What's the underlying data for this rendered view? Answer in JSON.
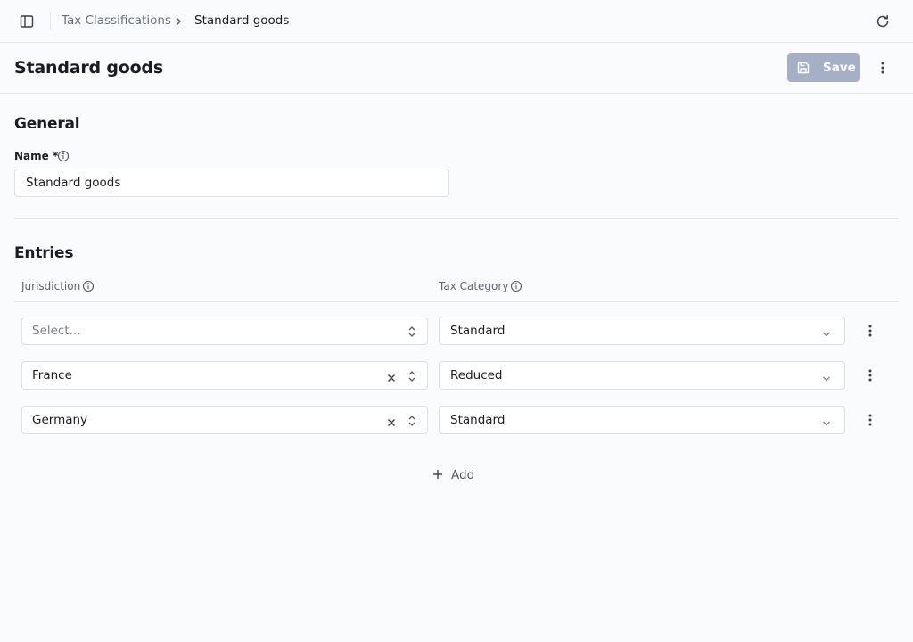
{
  "topbar": {
    "breadcrumb": [
      "Tax Classifications",
      "Standard goods"
    ]
  },
  "header": {
    "title": "Standard goods",
    "save_label": "Save"
  },
  "general": {
    "section_title": "General",
    "name_label": "Name *",
    "name_value": "Standard goods"
  },
  "entries": {
    "section_title": "Entries",
    "columns": [
      "Jurisdiction",
      "Tax Category"
    ],
    "rows": [
      {
        "jurisdiction": "Select...",
        "jurisdiction_placeholder": true,
        "tax_category": "Standard"
      },
      {
        "jurisdiction": "France",
        "tax_category": "Reduced"
      },
      {
        "jurisdiction": "Germany",
        "tax_category": "Standard"
      }
    ],
    "add_label": "Add"
  },
  "icons": {
    "sidebar_toggle": "sidebar-toggle-icon",
    "breadcrumb_separator": "chevron-right-icon",
    "refresh": "refresh-icon",
    "save": "save-disk-icon",
    "more": "more-vertical-icon",
    "info": "info-icon",
    "clear": "close-icon",
    "select": "chevron-up-down-icon",
    "dropdown": "chevron-down-icon",
    "add": "plus-icon"
  },
  "colors": {
    "save_button_bg": "#a5b0c7",
    "background": "#fafbfd",
    "border": "#dcdfe4"
  }
}
